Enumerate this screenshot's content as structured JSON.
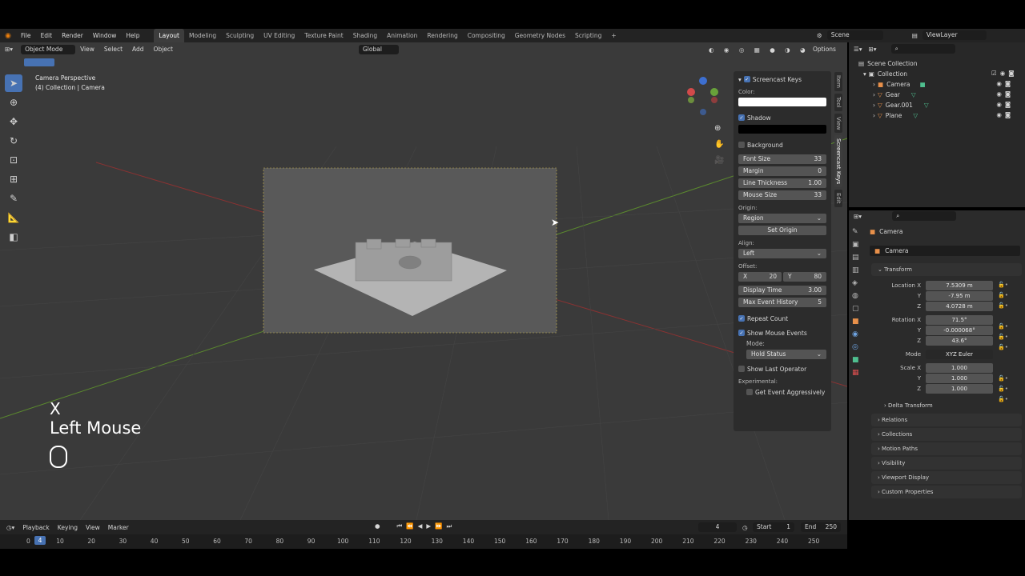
{
  "menus": [
    "File",
    "Edit",
    "Render",
    "Window",
    "Help"
  ],
  "workspaces": [
    "Layout",
    "Modeling",
    "Sculpting",
    "UV Editing",
    "Texture Paint",
    "Shading",
    "Animation",
    "Rendering",
    "Compositing",
    "Geometry Nodes",
    "Scripting"
  ],
  "scene": {
    "name": "Scene",
    "view_layer": "ViewLayer"
  },
  "viewport": {
    "mode": "Object Mode",
    "header_menus": [
      "View",
      "Select",
      "Add",
      "Object"
    ],
    "orientation": "Global",
    "options": "Options",
    "title": "Camera Perspective",
    "subtitle": "(4) Collection | Camera",
    "overlay_key": "X",
    "overlay_mouse": "Left Mouse"
  },
  "screencast": {
    "title": "Screencast Keys",
    "color_label": "Color:",
    "shadow": "Shadow",
    "background": "Background",
    "fields": [
      {
        "label": "Font Size",
        "value": "33"
      },
      {
        "label": "Margin",
        "value": "0"
      },
      {
        "label": "Line Thickness",
        "value": "1.00"
      },
      {
        "label": "Mouse Size",
        "value": "33"
      }
    ],
    "origin_label": "Origin:",
    "origin_value": "Region",
    "set_origin": "Set Origin",
    "align_label": "Align:",
    "align_value": "Left",
    "offset_label": "Offset:",
    "offset_x_label": "X",
    "offset_x": "20",
    "offset_y_label": "Y",
    "offset_y": "80",
    "display_time_label": "Display Time",
    "display_time": "3.00",
    "max_history_label": "Max Event History",
    "max_history": "5",
    "repeat_count": "Repeat Count",
    "show_mouse": "Show Mouse Events",
    "mode_label": "Mode:",
    "mode_value": "Hold Status",
    "show_last": "Show Last Operator",
    "experimental": "Experimental:",
    "get_event": "Get Event Aggressively"
  },
  "side_tabs": [
    "Item",
    "Tool",
    "View",
    "Screencast Keys",
    "Edit"
  ],
  "outliner": {
    "root": "Scene Collection",
    "collection": "Collection",
    "items": [
      "Camera",
      "Gear",
      "Gear.001",
      "Plane"
    ]
  },
  "properties": {
    "object_name": "Camera",
    "data_name": "Camera",
    "transform": "Transform",
    "location_label": "Location X",
    "loc_x": "7.5309 m",
    "loc_y": "-7.95 m",
    "loc_z": "4.0728 m",
    "rotation_label": "Rotation X",
    "rot_x": "71.5°",
    "rot_y": "-0.000068°",
    "rot_z": "43.6°",
    "y": "Y",
    "z": "Z",
    "mode_label": "Mode",
    "mode_value": "XYZ Euler",
    "scale_label": "Scale X",
    "sc_x": "1.000",
    "sc_y": "1.000",
    "sc_z": "1.000",
    "delta": "Delta Transform",
    "sections": [
      "Relations",
      "Collections",
      "Motion Paths",
      "Visibility",
      "Viewport Display",
      "Custom Properties"
    ]
  },
  "timeline": {
    "menus": [
      "Playback",
      "Keying",
      "View",
      "Marker"
    ],
    "current": "4",
    "start_label": "Start",
    "start": "1",
    "end_label": "End",
    "end": "250",
    "ticks": [
      "0",
      "10",
      "20",
      "30",
      "40",
      "50",
      "60",
      "70",
      "80",
      "90",
      "100",
      "110",
      "120",
      "130",
      "140",
      "150",
      "160",
      "170",
      "180",
      "190",
      "200",
      "210",
      "220",
      "230",
      "240",
      "250"
    ]
  },
  "colors": {
    "accent": "#4772b3",
    "panel": "#2c2c2c",
    "viewport": "#3b3b3b"
  }
}
